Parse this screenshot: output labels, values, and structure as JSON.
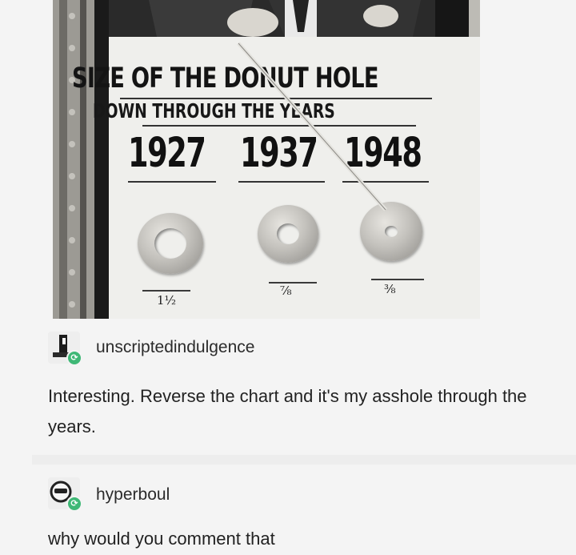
{
  "photo": {
    "sign_title": "SIZE OF THE DONUT HOLE",
    "sign_subtitle": "DOWN THROUGH THE YEARS",
    "years": [
      "1927",
      "1937",
      "1948"
    ],
    "sizes": [
      "1½",
      "⅞",
      "⅜"
    ]
  },
  "posts": [
    {
      "username": "unscriptedindulgence",
      "text": "Interesting. Reverse the chart and it's my asshole through the years."
    },
    {
      "username": "hyperboul",
      "text": "why would you comment that"
    }
  ],
  "colors": {
    "reblog_badge": "#3fb876",
    "background": "#f4f4f4"
  }
}
